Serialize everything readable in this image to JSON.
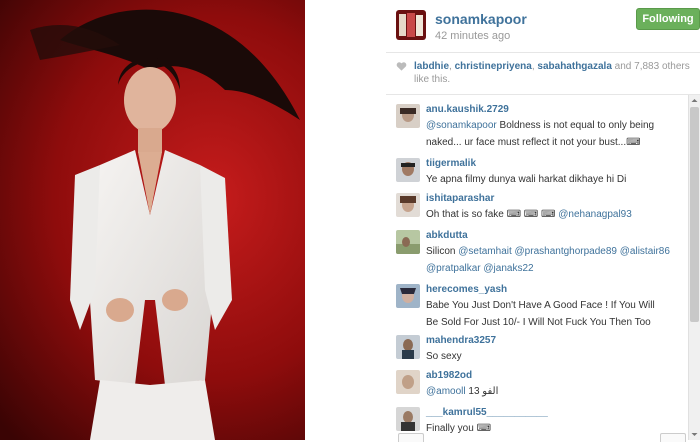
{
  "post": {
    "username": "sonamkapoor",
    "time": "42 minutes ago",
    "follow_label": "Following"
  },
  "likes": {
    "names": [
      "labdhie",
      "christinepriyena",
      "sabahathgazala"
    ],
    "sep1": ", ",
    "sep2": ", ",
    "and": " and ",
    "count": "7,883",
    "suffix": " others like this."
  },
  "comments": [
    {
      "user": "anu.kaushik.2729",
      "line1_mention": "@sonamkapoor",
      "line1": " Boldness is not equal to only being",
      "line2": "naked... ur face must reflect it not your bust...⌨"
    },
    {
      "user": "tiigermalik",
      "text": "Ye apna filmy dunya wali harkat dikhaye hi Di"
    },
    {
      "user": "ishitaparashar",
      "text": "Oh that is so fake ⌨ ⌨ ⌨ ",
      "mention": "@nehanagpal93"
    },
    {
      "user": "abkdutta",
      "line1_text": "Silicon ",
      "line1_mentions": "@setamhait @prashantghorpade89 @alistair86",
      "line2": "@pratpalkar @janaks22"
    },
    {
      "user": "herecomes_yash",
      "line1": "Babe You Just Don't Have A Good Face ! If You Will",
      "line2": "Be Sold For Just 10/- I Will Not Fuck You Then Too"
    },
    {
      "user": "mahendra3257",
      "text": "So sexy"
    },
    {
      "user": "ab1982od",
      "mention": "@amooll",
      "text": "  13 الفو"
    },
    {
      "user": "___kamrul55___________",
      "text": "Finally you ⌨"
    }
  ]
}
